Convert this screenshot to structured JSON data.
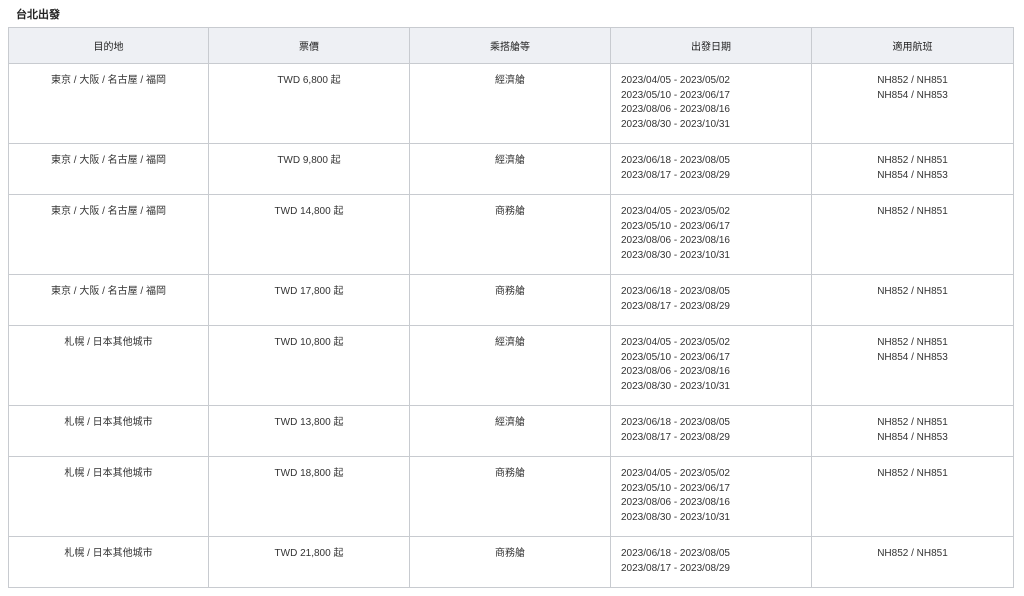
{
  "section_title": "台北出發",
  "table": {
    "headers": [
      "目的地",
      "票價",
      "乘搭艙等",
      "出發日期",
      "適用航班"
    ],
    "rows": [
      {
        "destination": "東京 / 大阪 / 名古屋 / 福岡",
        "fare": "TWD 6,800 起",
        "cabin": "經濟艙",
        "dates": [
          "2023/04/05 - 2023/05/02",
          "2023/05/10 - 2023/06/17",
          "2023/08/06 - 2023/08/16",
          "2023/08/30 - 2023/10/31"
        ],
        "flights": [
          "NH852 / NH851",
          "NH854 / NH853"
        ]
      },
      {
        "destination": "東京 / 大阪 / 名古屋 / 福岡",
        "fare": "TWD 9,800 起",
        "cabin": "經濟艙",
        "dates": [
          "2023/06/18 - 2023/08/05",
          "2023/08/17 - 2023/08/29"
        ],
        "flights": [
          "NH852 / NH851",
          "NH854 / NH853"
        ]
      },
      {
        "destination": "東京 / 大阪 / 名古屋 / 福岡",
        "fare": "TWD 14,800 起",
        "cabin": "商務艙",
        "dates": [
          "2023/04/05 - 2023/05/02",
          "2023/05/10 - 2023/06/17",
          "2023/08/06 - 2023/08/16",
          "2023/08/30 - 2023/10/31"
        ],
        "flights": [
          "NH852 / NH851"
        ]
      },
      {
        "destination": "東京 / 大阪 / 名古屋 / 福岡",
        "fare": "TWD 17,800 起",
        "cabin": "商務艙",
        "dates": [
          "2023/06/18 - 2023/08/05",
          "2023/08/17 - 2023/08/29"
        ],
        "flights": [
          "NH852 / NH851"
        ]
      },
      {
        "destination": "札幌 / 日本其他城市",
        "fare": "TWD 10,800 起",
        "cabin": "經濟艙",
        "dates": [
          "2023/04/05 - 2023/05/02",
          "2023/05/10 - 2023/06/17",
          "2023/08/06 - 2023/08/16",
          "2023/08/30 - 2023/10/31"
        ],
        "flights": [
          "NH852 / NH851",
          "NH854 / NH853"
        ]
      },
      {
        "destination": "札幌 / 日本其他城市",
        "fare": "TWD 13,800 起",
        "cabin": "經濟艙",
        "dates": [
          "2023/06/18 - 2023/08/05",
          "2023/08/17 - 2023/08/29"
        ],
        "flights": [
          "NH852 / NH851",
          "NH854 / NH853"
        ]
      },
      {
        "destination": "札幌 / 日本其他城市",
        "fare": "TWD 18,800 起",
        "cabin": "商務艙",
        "dates": [
          "2023/04/05 - 2023/05/02",
          "2023/05/10 - 2023/06/17",
          "2023/08/06 - 2023/08/16",
          "2023/08/30 - 2023/10/31"
        ],
        "flights": [
          "NH852 / NH851"
        ]
      },
      {
        "destination": "札幌 / 日本其他城市",
        "fare": "TWD 21,800 起",
        "cabin": "商務艙",
        "dates": [
          "2023/06/18 - 2023/08/05",
          "2023/08/17 - 2023/08/29"
        ],
        "flights": [
          "NH852 / NH851"
        ]
      }
    ]
  }
}
